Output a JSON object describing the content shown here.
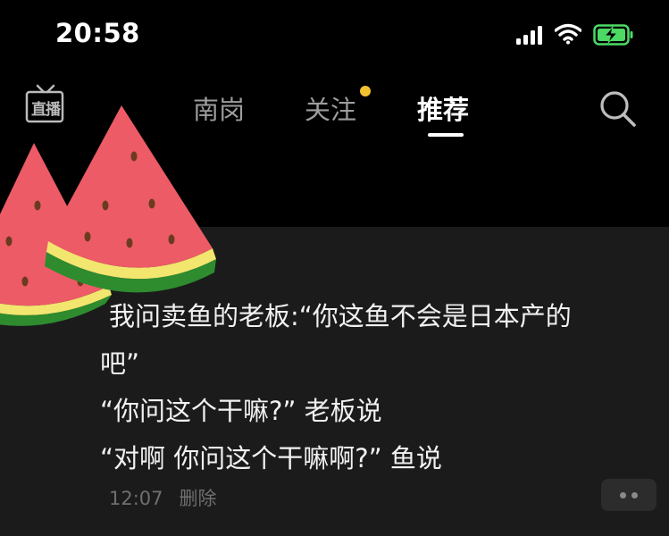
{
  "status_bar": {
    "time": "20:58"
  },
  "nav": {
    "live_label": "直播",
    "tabs": [
      {
        "label": "南岗"
      },
      {
        "label": "关注"
      },
      {
        "label": "推荐"
      }
    ],
    "active_tab": "推荐"
  },
  "post": {
    "lines": [
      "我问卖鱼的老板:“你这鱼不会是日本产的",
      "吧”",
      "“你问这个干嘛?” 老板说",
      "“对啊 你问这个干嘛啊?” 鱼说"
    ],
    "time": "12:07",
    "delete_label": "删除"
  },
  "colors": {
    "background": "#000000",
    "card": "#1b1b1b",
    "unread_dot": "#f2c230",
    "battery": "#4cd964"
  },
  "icons": [
    "live-tv-icon",
    "search-icon",
    "more-icon",
    "signal-icon",
    "wifi-icon",
    "battery-charging-icon",
    "watermelon-sticker"
  ]
}
